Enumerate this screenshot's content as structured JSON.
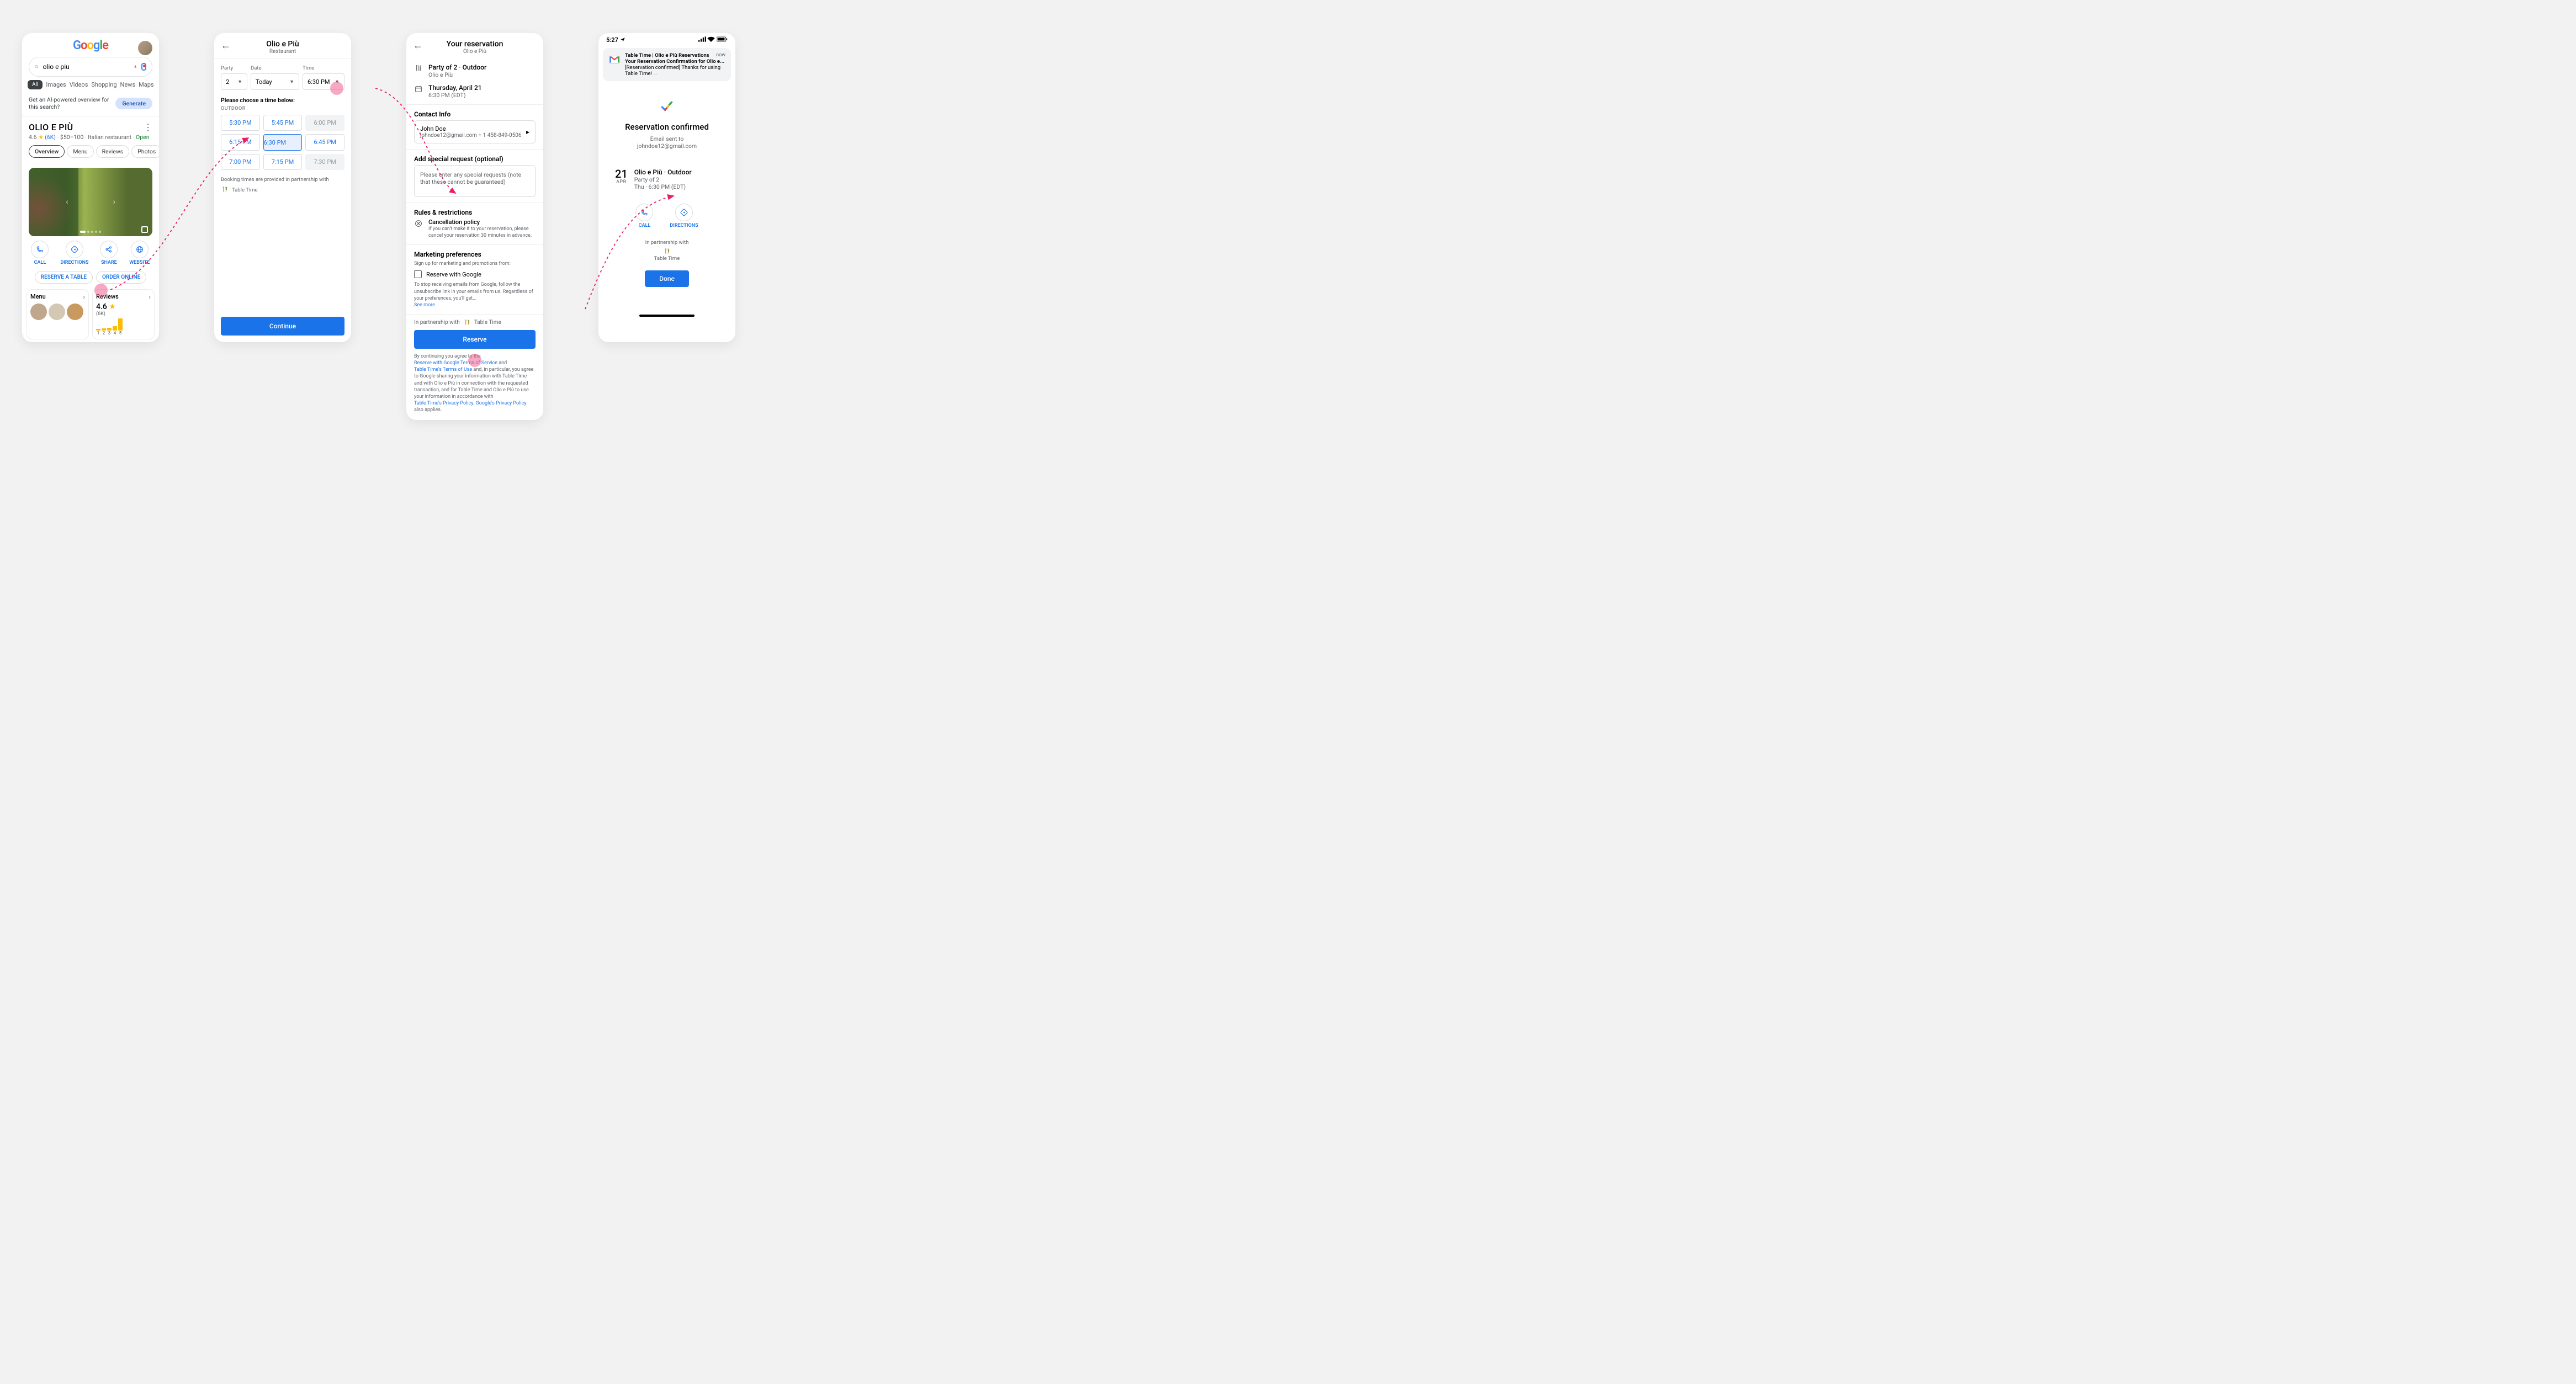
{
  "p1": {
    "search_value": "olio e piu",
    "tabs": [
      "All",
      "Images",
      "Videos",
      "Shopping",
      "News",
      "Maps"
    ],
    "ai_prompt": "Get an AI-powered overview for this search?",
    "ai_button": "Generate",
    "biz_name": "OLIO E PIÙ",
    "rating": "4.6",
    "reviews_link": "(6K)",
    "price": "$50–100",
    "cuisine": "Italian restaurant",
    "open": "Open",
    "chips": [
      "Overview",
      "Menu",
      "Reviews",
      "Photos"
    ],
    "actions": [
      "CALL",
      "DIRECTIONS",
      "SHARE",
      "WEBSITE"
    ],
    "cta": [
      "RESERVE A TABLE",
      "ORDER ONLINE"
    ],
    "card_menu": "Menu",
    "card_reviews": "Reviews",
    "rev_rating": "4.6",
    "rev_count": "(6K)",
    "histogram": [
      4,
      5,
      6,
      10,
      28
    ],
    "hist_labels": [
      "1",
      "2",
      "3",
      "4",
      "5"
    ]
  },
  "p2": {
    "title": "Olio e Più",
    "subtitle": "Restaurant",
    "party_lbl": "Party",
    "date_lbl": "Date",
    "time_lbl": "Time",
    "party_val": "2",
    "date_val": "Today",
    "time_val": "6:30 PM",
    "choose_lbl": "Please choose a time below:",
    "cat": "OUTDOOR",
    "slots": [
      {
        "t": "5:30 PM",
        "s": ""
      },
      {
        "t": "5:45 PM",
        "s": ""
      },
      {
        "t": "6:00 PM",
        "s": "dis"
      },
      {
        "t": "6:15 PM",
        "s": ""
      },
      {
        "t": "6:30 PM",
        "s": "sel"
      },
      {
        "t": "6:45 PM",
        "s": ""
      },
      {
        "t": "7:00 PM",
        "s": ""
      },
      {
        "t": "7:15 PM",
        "s": ""
      },
      {
        "t": "7:30 PM",
        "s": "dis"
      }
    ],
    "partner_txt": "Booking times are provided in partnership with",
    "partner_name": "Table Time",
    "continue": "Continue"
  },
  "p3": {
    "title": "Your reservation",
    "subtitle": "Olio e Più",
    "party_line": "Party of 2 · Outdoor",
    "rest_line": "Olio e Più",
    "date_line": "Thursday, April 21",
    "time_line": "6:30 PM (EDT)",
    "contact_hdr": "Contact Info",
    "contact_name": "John Doe",
    "contact_sub": "johndoe12@gmail.com   + 1 458-849-0506",
    "special_hdr": "Add special request (optional)",
    "special_ph": "Please enter any special requests (note that these cannot be guaranteed)",
    "rules_hdr": "Rules & restrictions",
    "cancel_t": "Cancellation policy",
    "cancel_b": "If you can't make it to your reservation, please cancel your reservation 30 minutes in advance.",
    "mkt_hdr": "Marketing preferences",
    "mkt_sub": "Sign up for marketing and promotions from:",
    "mkt_opt": "Reserve with Google",
    "mkt_fine1": "To stop receiving emails from Google, follow the unsubscribe link in your emails from us. Regardless of your preferences, you'll get...",
    "see_more": "See more",
    "partner_lbl": "In partnership with",
    "partner_name": "Table Time",
    "reserve": "Reserve",
    "legal1": "By continuing you agree to the",
    "legal_rwg": "Reserve with Google Terms of Service",
    "legal_and": " and",
    "legal_tt": "Table Time's Terms of Use",
    "legal2": " and, in particular, you agree to Google sharing your information with  Table Time and with Olio e Più in connection with the requested transaction, and for Table Time  and Olio e Più to use your information in accordance with",
    "legal_tp": "Table Time's Privacy Policy",
    "legal_gp": "Google's Privacy Policy",
    "legal_end": " also applies."
  },
  "p4": {
    "clock": "5:27",
    "notif": {
      "l1": "Table Time | Olio e Più Reservations",
      "now": "now",
      "l2": "Your Reservation Confirmation for Olio e...",
      "l3": "[Reservation confirmed] Thanks for using Table Time!"
    },
    "confirmed": "Reservation confirmed",
    "email_sent": "Email sent to",
    "email": "johndoe12@gmail.com",
    "day": "21",
    "month": "APR",
    "d_t1": "Olio e Più · Outdoor",
    "d_t2": "Party of 2",
    "d_t3": "Thu · 6:30 PM (EDT)",
    "act_call": "CALL",
    "act_dir": "DIRECTIONS",
    "partner_lbl": "In partnership with",
    "partner_name": "Table Time",
    "done": "Done"
  }
}
